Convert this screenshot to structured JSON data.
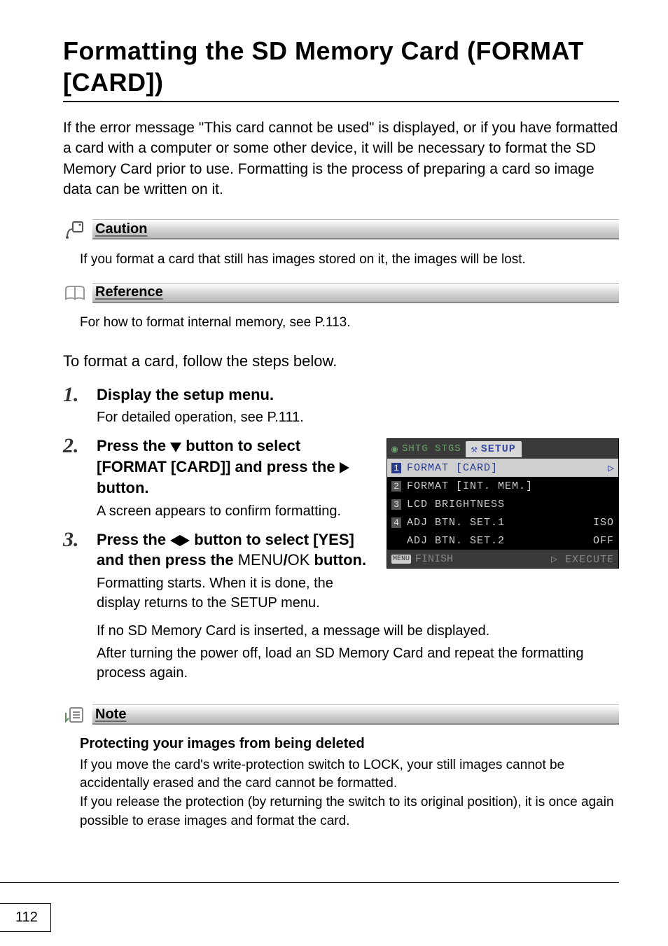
{
  "title": "Formatting the SD Memory Card (FORMAT [CARD])",
  "intro": "If the error message \"This card cannot be used\" is displayed, or if you have formatted a card with a computer or some other device, it will be necessary to format the SD Memory Card prior to use. Formatting is the process of preparing a card so image data can be written on it.",
  "caution": {
    "label": "Caution",
    "body": "If you format a card that still has images stored on it, the images will be lost."
  },
  "reference": {
    "label": "Reference",
    "body": "For how to format internal memory, see P.113."
  },
  "lead2": "To format a card, follow the steps below.",
  "steps": {
    "s1": {
      "head": "Display the setup menu.",
      "sub": "For detailed operation, see P.111."
    },
    "s2": {
      "head_a": "Press the ",
      "head_b": " button to select [FORMAT [CARD]] and press the ",
      "head_c": " button.",
      "sub": "A screen appears to confirm formatting."
    },
    "s3": {
      "head_a": "Press the ",
      "head_b": " button to select [YES] and then press the ",
      "menu": "MENU",
      "slash": "/",
      "ok": "OK",
      "head_c": " button.",
      "sub1": "Formatting starts. When it is done, the display returns to the SETUP menu.",
      "sub2": "If no SD Memory Card is inserted, a message will be displayed.",
      "sub3": "After turning the power off, load an SD Memory Card and repeat the formatting process again."
    }
  },
  "screenshot": {
    "tab_inactive": "SHTG STGS",
    "tab_active": "SETUP",
    "rows": [
      {
        "n": "1",
        "label": "FORMAT [CARD]",
        "val": "",
        "sel": true,
        "arrow": true
      },
      {
        "n": "2",
        "label": "FORMAT [INT. MEM.]",
        "val": "",
        "sel": false,
        "arrow": false
      },
      {
        "n": "3",
        "label": "LCD BRIGHTNESS",
        "val": "",
        "sel": false,
        "arrow": false
      },
      {
        "n": "4",
        "label": "ADJ BTN. SET.1",
        "val": "ISO",
        "sel": false,
        "arrow": false
      },
      {
        "n": "",
        "label": "ADJ BTN. SET.2",
        "val": "OFF",
        "sel": false,
        "arrow": false
      }
    ],
    "footer_menu": "MENU",
    "footer_finish": "FINISH",
    "footer_execute": "EXECUTE"
  },
  "note": {
    "label": "Note",
    "title": "Protecting your images from being deleted",
    "body1": "If you move the card's write-protection switch to LOCK, your still images cannot be accidentally erased and the card cannot be formatted.",
    "body2": "If you release the protection (by returning the switch to its original position), it is once again possible to erase images and format the card."
  },
  "page_number": "112"
}
